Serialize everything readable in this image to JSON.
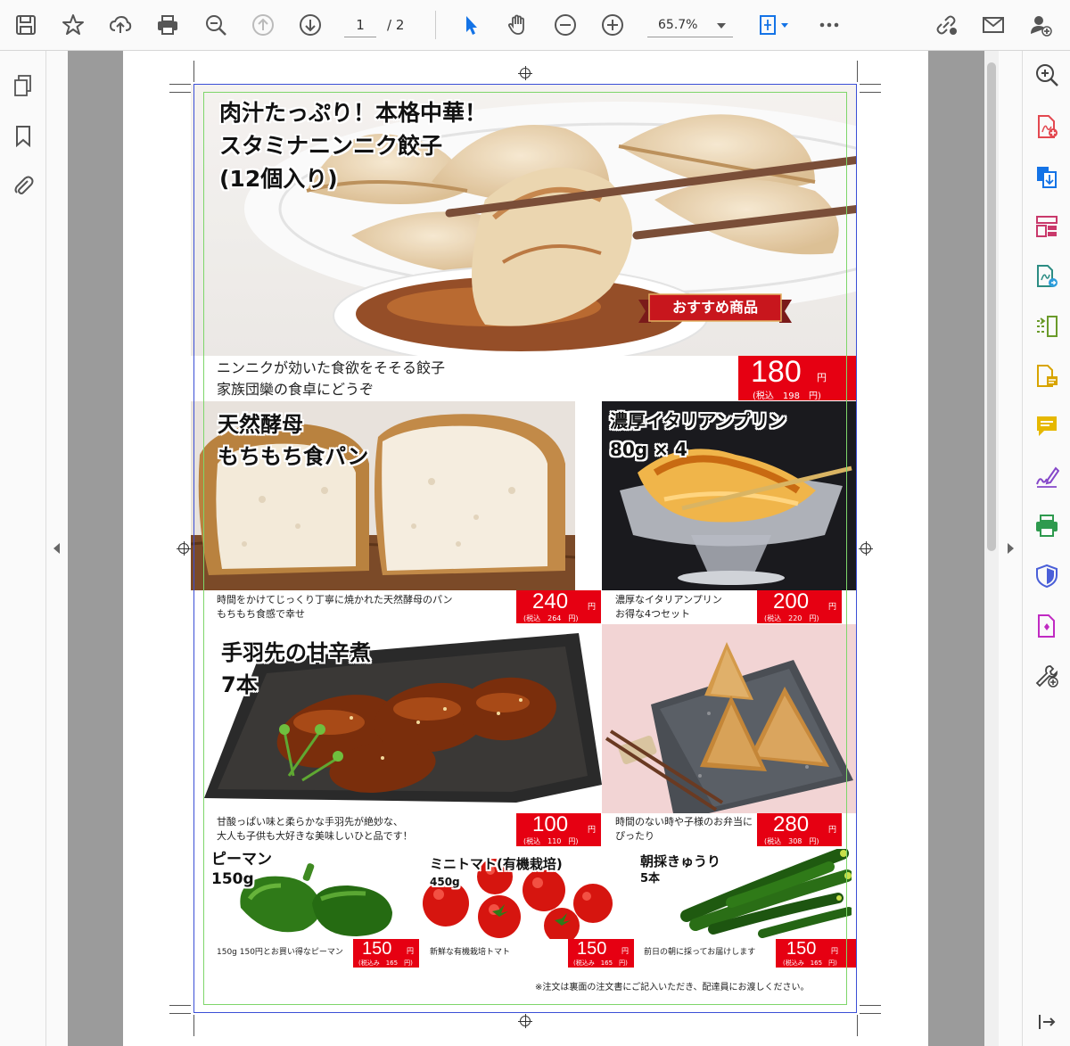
{
  "toolbar": {
    "current_page": "1",
    "total_pages": "/ 2",
    "zoom": "65.7%"
  },
  "colors": {
    "price_red": "#e60012",
    "trim_blue": "#3b4fd6",
    "safe_green": "#7ed66a"
  },
  "flyer": {
    "badge": "おすすめ商品",
    "footnote": "※注文は裏面の注文書にご記入いただき、配達員にお渡しください。",
    "gyoza": {
      "title1": "肉汁たっぷり！本格中華！",
      "title2": "スタミナニンニク餃子",
      "title3": "(12個入り)",
      "desc1": "ニンニクが効いた食欲をそそる餃子",
      "desc2": "家族団欒の食卓にどうぞ",
      "price": "180",
      "yen": "円",
      "tax": "(税込　198　円)"
    },
    "bread": {
      "title1": "天然酵母",
      "title2": "もちもち食パン",
      "desc1": "時間をかけてじっくり丁寧に焼かれた天然酵母のパン",
      "desc2": "もちもち食感で幸せ",
      "price": "240",
      "yen": "円",
      "tax": "(税込　264　円)"
    },
    "pudding": {
      "title1": "濃厚イタリアンプリン",
      "title2": "80g × 4",
      "desc1": "濃厚なイタリアンプリン",
      "desc2": "お得な4つセット",
      "price": "200",
      "yen": "円",
      "tax": "(税込　220　円)"
    },
    "wings": {
      "title1": "手羽先の甘辛煮",
      "title2": "7本",
      "desc1": "甘酸っぱい味と柔らかな手羽先が絶妙な、",
      "desc2": "大人も子供も大好きな美味しいひと品です！",
      "price": "100",
      "yen": "円",
      "tax": "(税込　110　円)"
    },
    "onigiri": {
      "desc1": "時間のない時や子様のお弁当に",
      "desc2": "ぴったり",
      "price": "280",
      "yen": "円",
      "tax": "(税込　308　円)"
    },
    "pepper": {
      "title1": "ピーマン",
      "title2": "150g",
      "desc1": "150g 150円とお買い得なピーマン",
      "price": "150",
      "yen": "円",
      "tax": "(税込み　165　円)"
    },
    "tomato": {
      "title1": "ミニトマト(有機栽培)",
      "title2": "450g",
      "desc1": "新鮮な有機栽培トマト",
      "price": "150",
      "yen": "円",
      "tax": "(税込み　165　円)"
    },
    "cucumber": {
      "title1": "朝採きゅうり",
      "title2": "5本",
      "desc1": "前日の朝に採ってお届けします",
      "price": "150",
      "yen": "円",
      "tax": "(税込み　165　円)"
    }
  }
}
